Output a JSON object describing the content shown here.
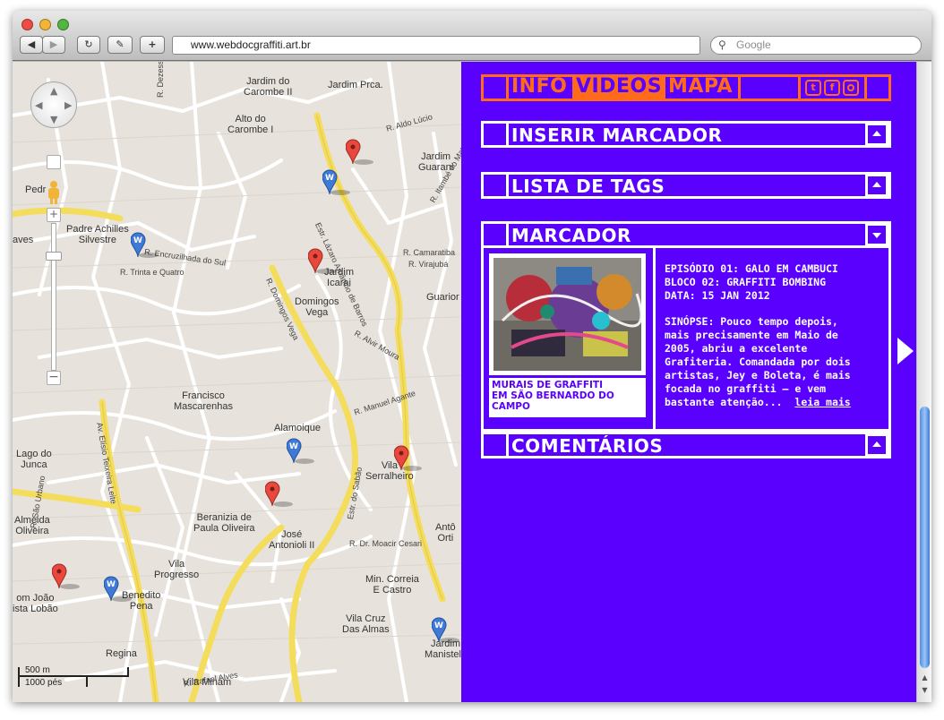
{
  "browser": {
    "url": "www.webdocgraffiti.art.br",
    "search_placeholder": "Google",
    "back_icon": "back-arrow-icon",
    "forward_icon": "forward-arrow-icon",
    "reload_icon": "reload-icon",
    "snap_icon": "snapback-icon",
    "add_icon": "add-bookmark-icon"
  },
  "map": {
    "labels": [
      {
        "id": "l1",
        "text": "Jardim do\nCarombe II"
      },
      {
        "id": "l2",
        "text": "Jardim Prca."
      },
      {
        "id": "l3",
        "text": "Alto do\nCarombe I"
      },
      {
        "id": "l4",
        "text": "Jardim\nGuarani"
      },
      {
        "id": "l5",
        "text": "Pedr"
      },
      {
        "id": "l6",
        "text": "Padre Achilles\nSilvestre"
      },
      {
        "id": "l7",
        "text": "aves"
      },
      {
        "id": "l8",
        "text": "Jardim\nIcarai"
      },
      {
        "id": "l9",
        "text": "Domingos\nVega"
      },
      {
        "id": "l10",
        "text": "Guarior"
      },
      {
        "id": "l11",
        "text": "Francisco\nMascarenhas"
      },
      {
        "id": "l12",
        "text": "Alamoique"
      },
      {
        "id": "l13",
        "text": "Lago do\nJunca"
      },
      {
        "id": "l14",
        "text": "Vila\nSerralheiro"
      },
      {
        "id": "l15",
        "text": "Almeida\nOliveira"
      },
      {
        "id": "l16",
        "text": "Beranizia de\nPaula Oliveira"
      },
      {
        "id": "l17",
        "text": "José\nAntonioli II"
      },
      {
        "id": "l18",
        "text": "Vila\nProgresso"
      },
      {
        "id": "l19",
        "text": "Antô\nOrti"
      },
      {
        "id": "l20",
        "text": "Min. Correia\nE Castro"
      },
      {
        "id": "l21",
        "text": "om João\nista Lobão"
      },
      {
        "id": "l22",
        "text": "Benedito\nPena"
      },
      {
        "id": "l23",
        "text": "Vila Cruz\nDas Almas"
      },
      {
        "id": "l24",
        "text": "Regina"
      },
      {
        "id": "l25",
        "text": "Jardim\nManistela"
      },
      {
        "id": "l26",
        "text": "Vila Minam"
      }
    ],
    "streets": [
      {
        "id": "s1",
        "text": "R. Dezessete"
      },
      {
        "id": "s2",
        "text": "Estr. Lázaro Amâncio de Barros"
      },
      {
        "id": "s3",
        "text": "R. Domingos Vega"
      },
      {
        "id": "s4",
        "text": "R. Trinta e Quatro"
      },
      {
        "id": "s5",
        "text": "R. Encruzilhada do Sul"
      },
      {
        "id": "s6",
        "text": "Av. Elísio Teixeira Leite"
      },
      {
        "id": "s7",
        "text": "Estr. do Sabão"
      },
      {
        "id": "s8",
        "text": "R. Manuel Agante"
      },
      {
        "id": "s9",
        "text": "R. Dr. Moacir Cesari"
      },
      {
        "id": "s10",
        "text": "R. Camaratiba"
      },
      {
        "id": "s11",
        "text": "R. Virajubá"
      },
      {
        "id": "s12",
        "text": "R. Rafael Alves"
      },
      {
        "id": "s13",
        "text": "R. São Urbano"
      },
      {
        "id": "s14",
        "text": "R. Alvir Moura"
      },
      {
        "id": "s15",
        "text": "R. Itambé do Mato"
      },
      {
        "id": "s16",
        "text": "R. Aldo Lúcio"
      }
    ],
    "scale_metric": "500 m",
    "scale_imperial": "1000 pés",
    "markers": [
      {
        "id": "m1",
        "color": "red",
        "icon": "red-map-marker-icon"
      },
      {
        "id": "m2",
        "color": "blue",
        "icon": "blue-w-marker-icon"
      },
      {
        "id": "m3",
        "color": "blue",
        "icon": "blue-w-marker-icon"
      },
      {
        "id": "m4",
        "color": "red",
        "icon": "red-map-marker-icon"
      },
      {
        "id": "m5",
        "color": "blue",
        "icon": "blue-w-marker-icon"
      },
      {
        "id": "m6",
        "color": "red",
        "icon": "red-map-marker-icon"
      },
      {
        "id": "m7",
        "color": "red",
        "icon": "red-map-marker-icon"
      },
      {
        "id": "m8",
        "color": "red",
        "icon": "red-map-marker-icon"
      },
      {
        "id": "m9",
        "color": "blue",
        "icon": "blue-w-marker-icon"
      },
      {
        "id": "m10",
        "color": "blue",
        "icon": "blue-w-marker-icon"
      }
    ]
  },
  "panel": {
    "nav": {
      "info": "INFO",
      "videos": "VIDEOS",
      "mapa": "MAPA",
      "social": [
        "twitter-icon",
        "facebook-icon",
        "instagram-icon"
      ]
    },
    "sections": {
      "inserir": "INSERIR MARCADOR",
      "tags": "LISTA DE TAGS",
      "marcador": "MARCADOR",
      "comentarios": "COMENTÁRIOS"
    },
    "marker_card": {
      "caption_line1": "MURAIS DE GRAFFITI",
      "caption_line2": "EM SÃO BERNARDO DO",
      "caption_line3": "CAMPO",
      "episode": "EPISÓDIO 01: GALO EM CAMBUCI",
      "block": "BLOCO 02: GRAFFITI BOMBING",
      "date": "DATA: 15 JAN 2012",
      "synopsis_lines": [
        "SINÓPSE: Pouco tempo depois,",
        "mais precisamente em Maio de",
        "2005, abriu a excelente",
        "Grafiteria. Comandada por dois",
        "artistas, Jey e Boleta, é mais",
        "focada no graffiti – e vem",
        "bastante atenção..."
      ],
      "read_more": "leia mais",
      "next_icon": "next-arrow-icon"
    },
    "colors": {
      "panel_bg": "#5a00ff",
      "nav_accent": "#ff6b1a",
      "nav_inactive": "#ff6b1a",
      "border": "#ffffff"
    }
  }
}
